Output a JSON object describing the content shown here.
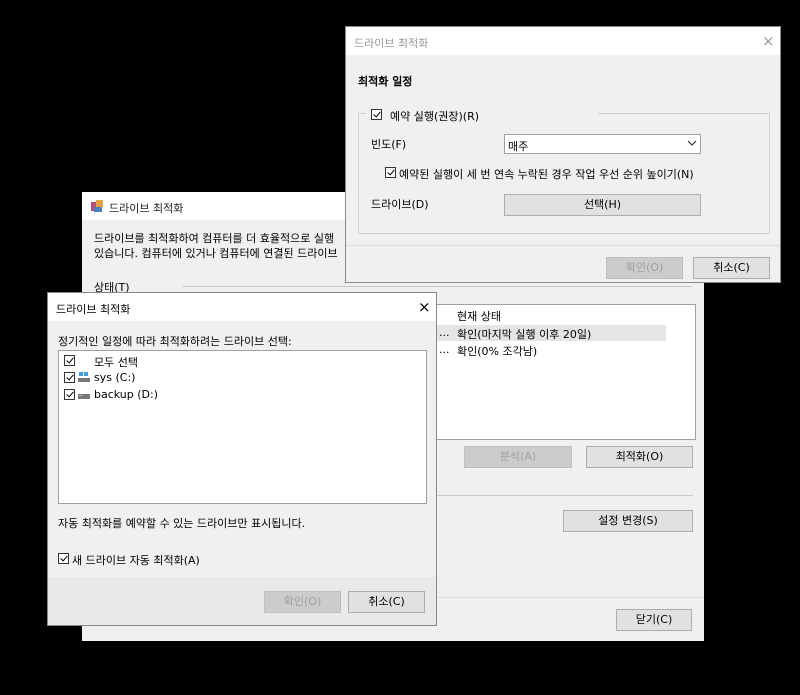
{
  "main": {
    "title": "드라이브 최적화",
    "desc_line1": "드라이브를 최적화하여 컴퓨터를 더 효율적으로 실행",
    "desc_line2": "있습니다. 컴퓨터에 있거나 컴퓨터에 연결된 드라이브",
    "status_label": "상태(T)",
    "column_current_status": "현재 상태",
    "rows": [
      {
        "ellipsis": "...",
        "status": "확인(마지막 실행 이후 20일)"
      },
      {
        "ellipsis": "...",
        "status": "확인(0% 조각남)"
      }
    ],
    "analyze_button": "분석(A)",
    "optimize_button": "최적화(O)",
    "change_settings_button": "설정 변경(S)",
    "close_button": "닫기(C)"
  },
  "schedule": {
    "title": "드라이브 최적화",
    "heading": "최적화 일정",
    "run_on_schedule": "예약 실행(권장)(R)",
    "frequency_label": "빈도(F)",
    "frequency_value": "매주",
    "increase_priority": "예약된 실행이 세 번 연속 누락된 경우 작업 우선 순위 높이기(N)",
    "drives_label": "드라이브(D)",
    "select_button": "선택(H)",
    "ok_button": "확인(O)",
    "cancel_button": "취소(C)"
  },
  "select_dialog": {
    "title": "드라이브 최적화",
    "instruction": "정기적인 일정에 따라 최적화하려는 드라이브 선택:",
    "select_all": "모두 선택",
    "drives": [
      {
        "label": "sys (C:)",
        "icon": "system-drive-icon"
      },
      {
        "label": "backup (D:)",
        "icon": "drive-icon"
      }
    ],
    "note": "자동 최적화를 예약할 수 있는 드라이브만 표시됩니다.",
    "auto_new": "새 드라이브 자동 최적화(A)",
    "ok_button": "확인(O)",
    "cancel_button": "취소(C)"
  }
}
